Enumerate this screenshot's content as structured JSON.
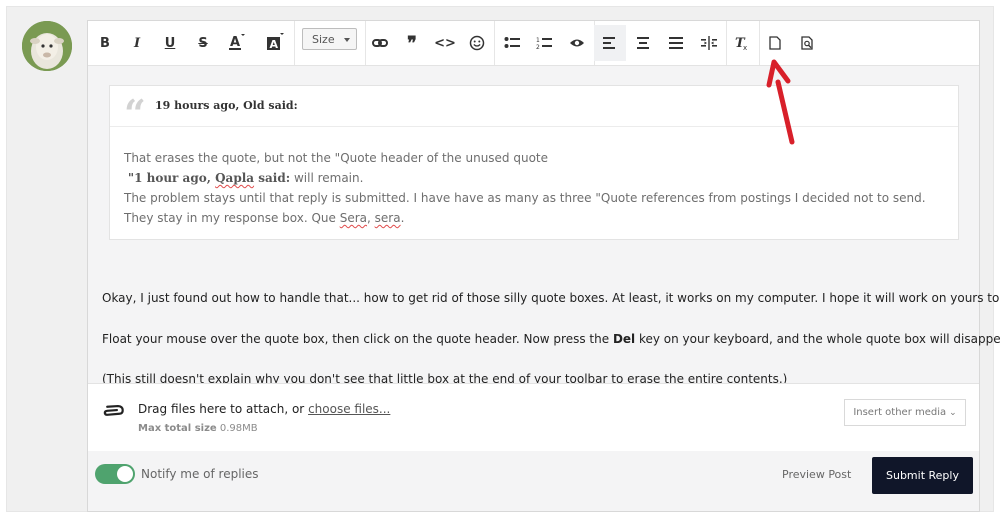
{
  "toolbar": {
    "size_label": "Size",
    "buttons": [
      "bold",
      "italic",
      "underline",
      "strikethrough",
      "font-color",
      "background-color",
      "size",
      "link",
      "quote",
      "code",
      "emoji",
      "bulleted-list",
      "numbered-list",
      "spoiler",
      "align-left",
      "align-center",
      "align-justify",
      "align-split",
      "remove-format",
      "new-document",
      "preview"
    ]
  },
  "quote": {
    "cite": "19 hours ago, Old said:",
    "line1": "That erases the quote, but not the \"Quote header of the unused quote",
    "nested_cite_pre": "\"1 hour ago, ",
    "nested_cite_name": "Qapla",
    "nested_cite_post": " said:",
    "nested_rest": " will remain.",
    "line3a": "The problem stays until that reply is submitted. I have have as many as three  \"Quote references from postings I decided not to send. They stay in my response box. Que ",
    "sera1": "Sera",
    "sep": ", ",
    "sera2": "sera",
    "end": "."
  },
  "body": {
    "p1": "Okay, I just found out how to handle that... how to get rid of those silly quote boxes. At least, it works on my computer. I hope it will work on yours too.",
    "p2_pre": "Float your mouse over the quote box, then click on the quote header. Now press the ",
    "p2_key": "Del",
    "p2_post": " key on your keyboard, and the whole quote box will disappear.",
    "p3": "(This still doesn't explain why you don't see that little box at the end of your toolbar to erase the entire contents.)"
  },
  "attach": {
    "drag_text": "Drag files here to attach, or ",
    "choose_link": "choose files...",
    "max_label": "Max total size",
    "max_value": " 0.98MB",
    "insert_media": "Insert other media"
  },
  "footer": {
    "notify": "Notify me of replies",
    "preview": "Preview Post",
    "submit": "Submit Reply"
  },
  "colors": {
    "accent": "#101629",
    "toggle": "#4fa36e",
    "arrow": "#d8202a"
  }
}
